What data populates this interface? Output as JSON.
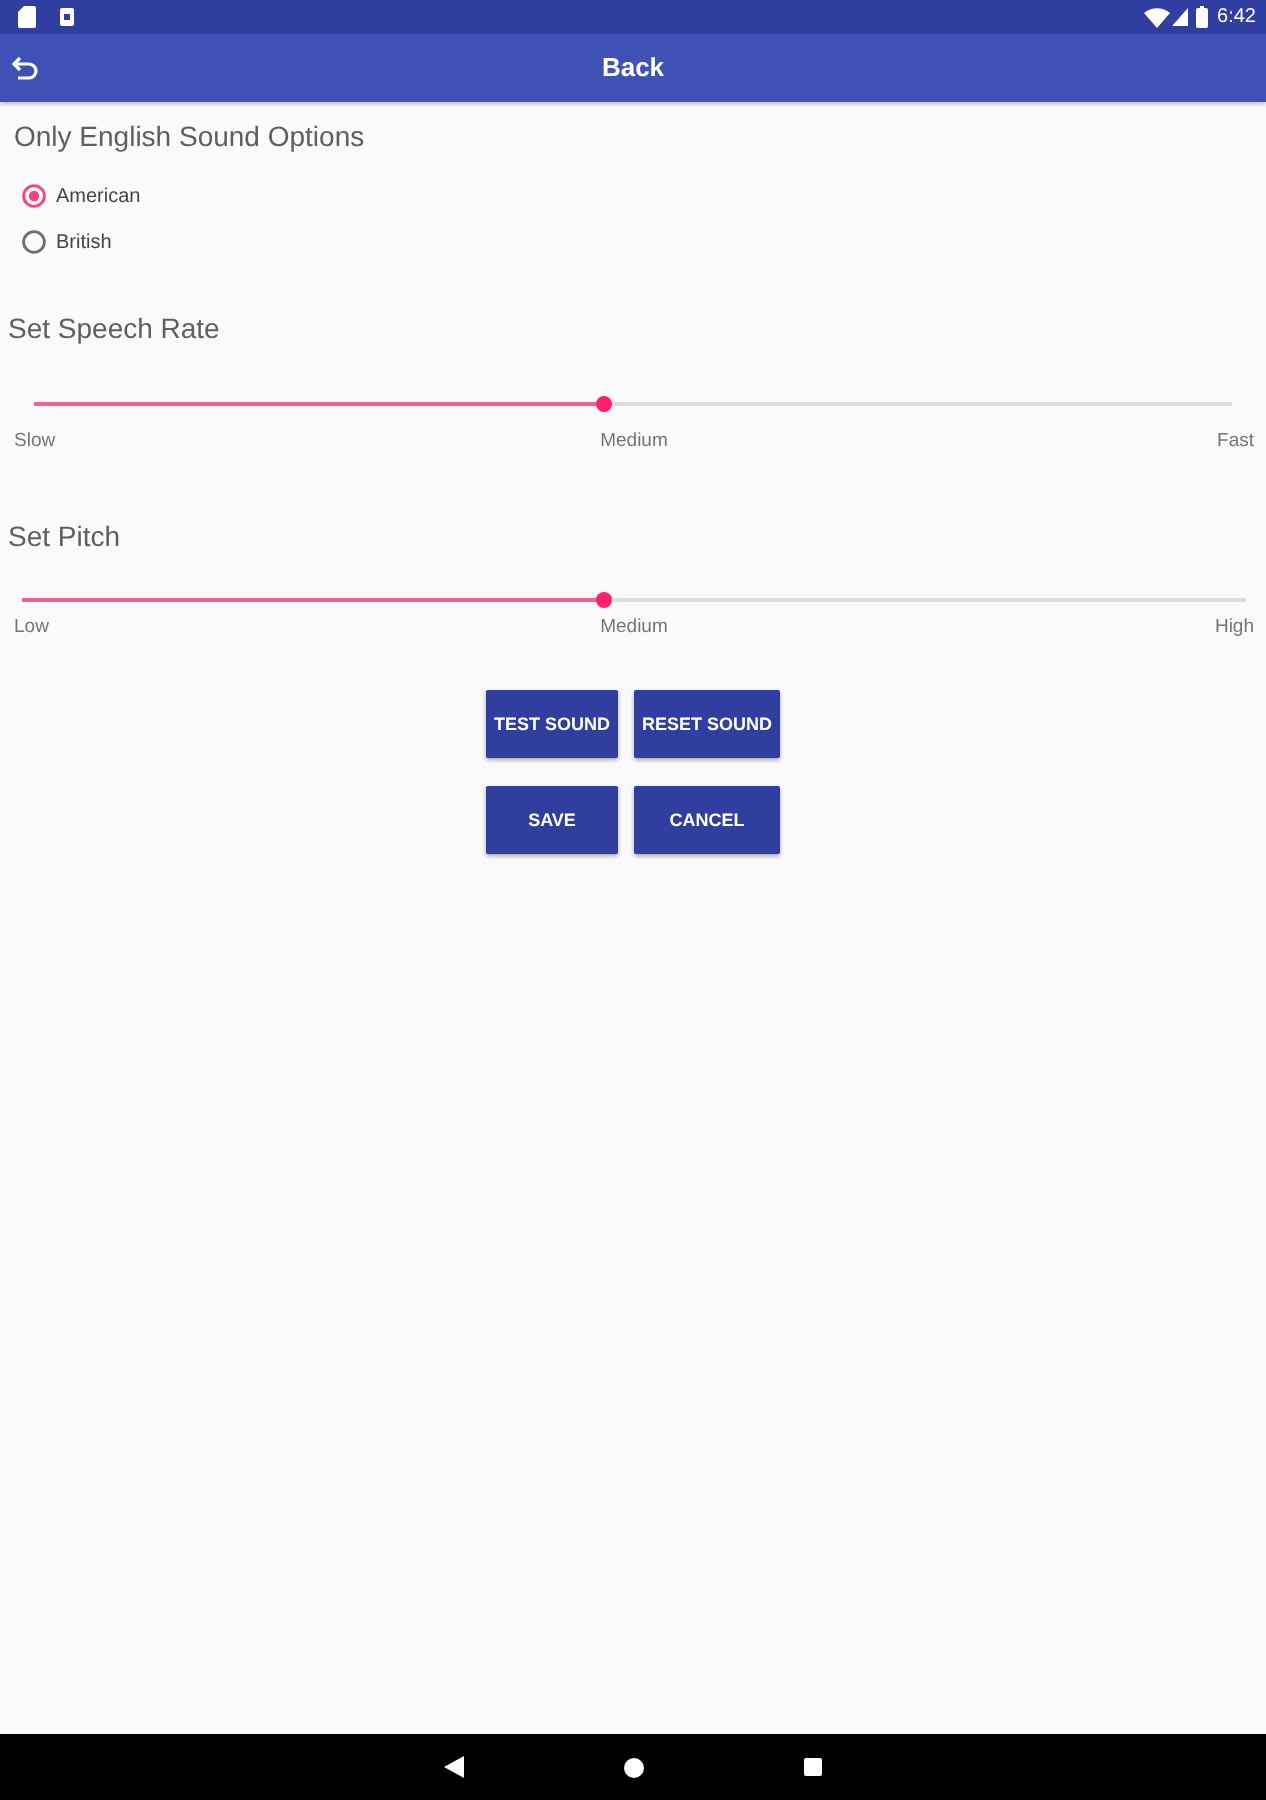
{
  "status_bar": {
    "time": "6:42"
  },
  "app_bar": {
    "title": "Back"
  },
  "accent": {
    "heading": "Only English Sound Options",
    "options": [
      {
        "label": "American",
        "selected": true
      },
      {
        "label": "British",
        "selected": false
      }
    ]
  },
  "sliders": [
    {
      "heading": "Set Speech Rate",
      "level": 0.475,
      "labels": [
        "Slow",
        "Medium",
        "Fast"
      ]
    },
    {
      "heading": "Set Pitch",
      "level": 0.475,
      "labels": [
        "Low",
        "Medium",
        "High"
      ]
    }
  ],
  "buttons": [
    {
      "label": "TEST SOUND"
    },
    {
      "label": "RESET SOUND"
    },
    {
      "label": "SAVE"
    },
    {
      "label": "CANCEL"
    }
  ]
}
